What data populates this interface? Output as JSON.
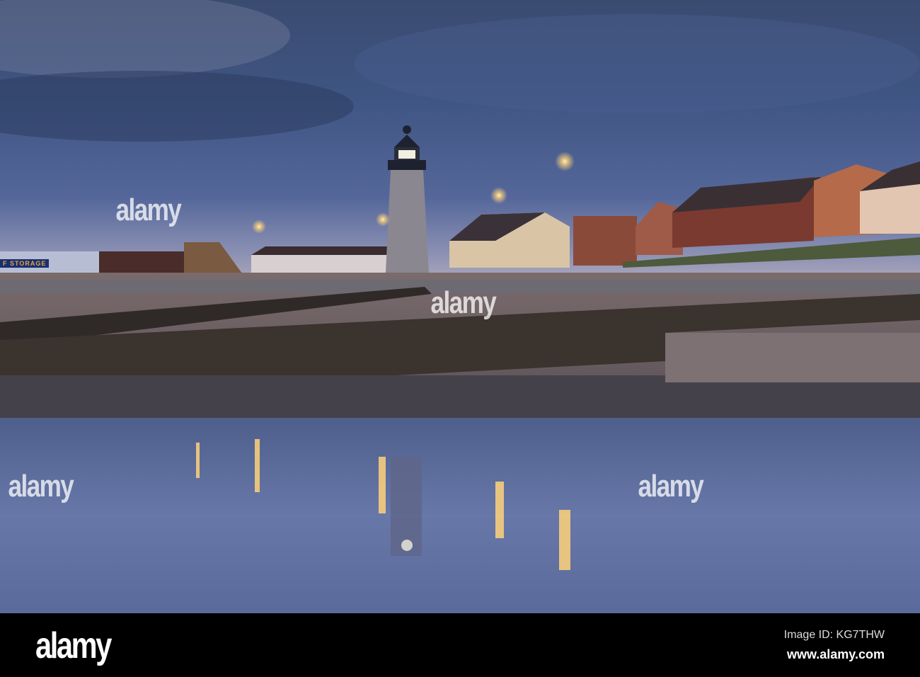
{
  "photo": {
    "subject": "lighthouse-seafront-dusk",
    "sign_text": "F STORAGE",
    "watermark": "alamy",
    "colors": {
      "sky_top": "#2f4063",
      "sky_horizon": "#9ea2bd",
      "beach": "#6e5f60",
      "water": "#5b6b9c",
      "lamp": "#ffd27a"
    }
  },
  "footer": {
    "logo": "alamy",
    "image_id": "Image ID: KG7THW",
    "website": "www.alamy.com"
  }
}
